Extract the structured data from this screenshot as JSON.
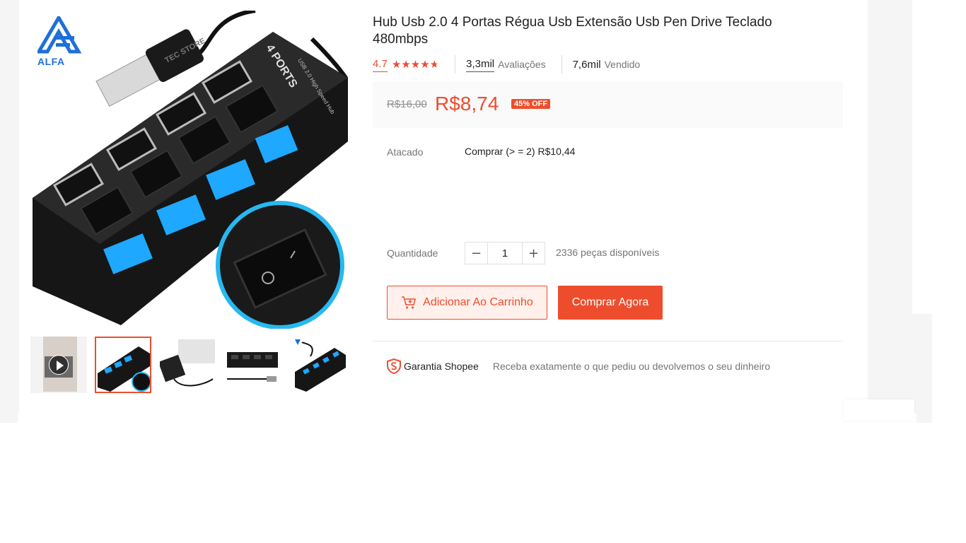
{
  "product": {
    "title": "Hub Usb 2.0 4 Portas Régua Usb Extensão Usb Pen Drive Teclado 480mbps",
    "rating": "4.7",
    "stars": 4.7,
    "reviews_count": "3,3mil",
    "reviews_label": "Avaliações",
    "sold_count": "7,6mil",
    "sold_label": "Vendido"
  },
  "image": {
    "logo_text": "ALFA",
    "brand_text": "TEC STORE",
    "hub_label": "4 PORTS",
    "hub_sublabel": "USB 2.0 High Speed Hub"
  },
  "price": {
    "original": "R$16,00",
    "current": "R$8,74",
    "discount": "45% OFF"
  },
  "wholesale": {
    "label": "Atacado",
    "value": "Comprar (> = 2) R$10,44"
  },
  "quantity": {
    "label": "Quantidade",
    "value": "1",
    "stock": "2336 peças disponíveis"
  },
  "actions": {
    "add_to_cart": "Adicionar Ao Carrinho",
    "buy_now": "Comprar Agora"
  },
  "guarantee": {
    "title": "Garantia Shopee",
    "description": "Receba exatamente o que pediu ou devolvemos o seu dinheiro"
  },
  "colors": {
    "accent": "#ee4d2d",
    "hub_light": "#1ea8ff"
  },
  "icons": {
    "star": "star-icon",
    "cart": "cart-add-icon",
    "minus": "minus-icon",
    "plus": "plus-icon",
    "shield": "shopee-guarantee-icon",
    "play": "play-icon"
  }
}
